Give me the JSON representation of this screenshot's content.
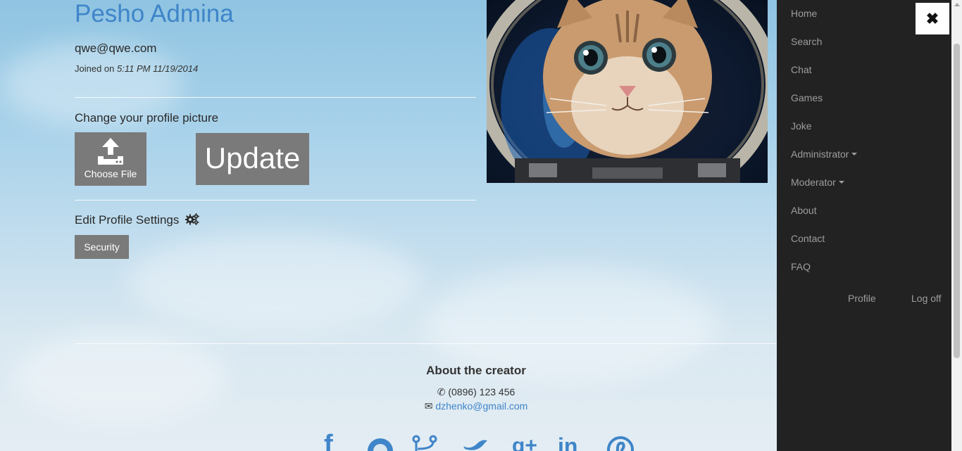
{
  "profile": {
    "name": "Pesho Admina",
    "email": "qwe@qwe.com",
    "joined_label": "Joined on",
    "joined_value": "5:11 PM 11/19/2014"
  },
  "picture_section": {
    "title": "Change your profile picture",
    "choose_file_label": "Choose File",
    "update_label": "Update"
  },
  "settings_section": {
    "title": "Edit Profile Settings",
    "security_label": "Security"
  },
  "nav": {
    "items": [
      "Home",
      "Search",
      "Chat",
      "Games",
      "Joke",
      "Administrator",
      "Moderator",
      "About",
      "Contact",
      "FAQ"
    ],
    "profile_label": "Profile",
    "logoff_label": "Log off",
    "close_glyph": "✖"
  },
  "footer": {
    "title": "About the creator",
    "phone": "(0896) 123 456",
    "email": "dzhenko@gmail.com",
    "social_icons": [
      "facebook-icon",
      "github-icon",
      "git-icon",
      "twitter-icon",
      "google-plus-icon",
      "linkedin-icon",
      "pinterest-icon"
    ]
  },
  "colors": {
    "accent": "#3f85c9",
    "nav_bg": "#222222",
    "button_bg": "#7a7a7a"
  }
}
